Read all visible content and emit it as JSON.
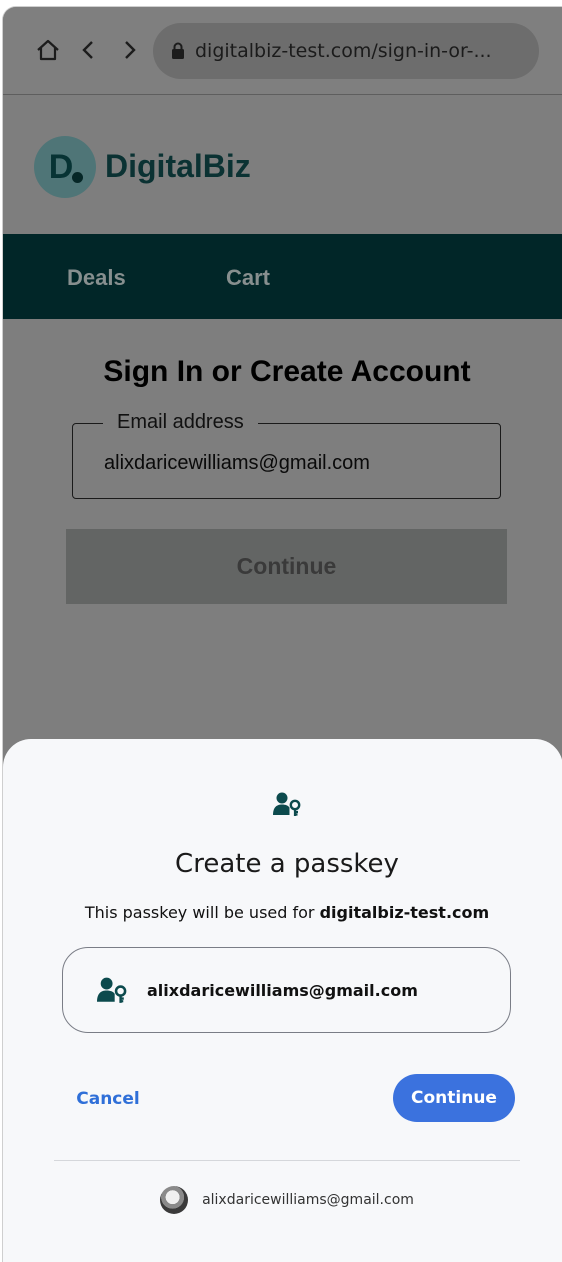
{
  "browser": {
    "url": "digitalbiz-test.com/sign-in-or-...",
    "icons": [
      "home-icon",
      "back-icon",
      "forward-icon",
      "lock-icon"
    ]
  },
  "site": {
    "logo_letter": "D",
    "logo_text": "DigitalBiz",
    "nav": [
      {
        "label": "Deals"
      },
      {
        "label": "Cart"
      }
    ],
    "brand_color": "#012628"
  },
  "page": {
    "title": "Sign In or Create Account",
    "email_label": "Email address",
    "email_value": "alixdaricewilliams@gmail.com",
    "continue_label": "Continue"
  },
  "passkey_sheet": {
    "title": "Create a passkey",
    "subtitle_prefix": "This passkey will be used for ",
    "subtitle_domain": "digitalbiz-test.com",
    "account_email": "alixdaricewilliams@gmail.com",
    "cancel_label": "Cancel",
    "continue_label": "Continue",
    "footer_email": "alixdaricewilliams@gmail.com",
    "accent_color": "#3b72de",
    "icon": "passkey-icon"
  }
}
